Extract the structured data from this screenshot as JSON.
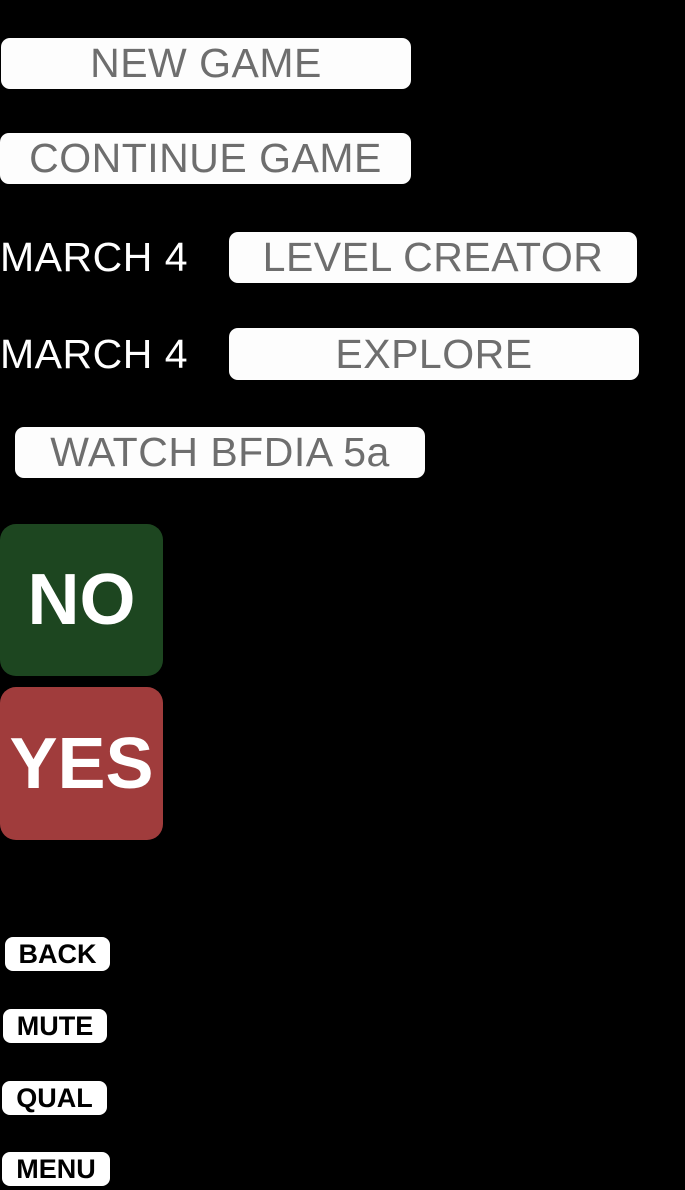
{
  "screen": {
    "background_color": "#000000",
    "kind": "game-main-menu"
  },
  "menu": {
    "new_game_label": "NEW GAME",
    "continue_game_label": "CONTINUE GAME",
    "level_creator_label": "LEVEL CREATOR",
    "level_creator_date": "MARCH 4",
    "explore_label": "EXPLORE",
    "explore_date": "MARCH 4",
    "watch_label": "WATCH BFDIA 5a"
  },
  "prompt": {
    "no_label": "NO",
    "yes_label": "YES",
    "no_color": "#1d4620",
    "yes_color": "#a03c3c"
  },
  "controls": {
    "back_label": "BACK",
    "mute_label": "MUTE",
    "qual_label": "QUAL",
    "menu_label": "MENU"
  },
  "style": {
    "button_fill": "#fdfdfd",
    "button_text": "#6e6e6e",
    "chip_fill": "#ffffff",
    "chip_text": "#000000",
    "plain_text": "#ffffff"
  }
}
